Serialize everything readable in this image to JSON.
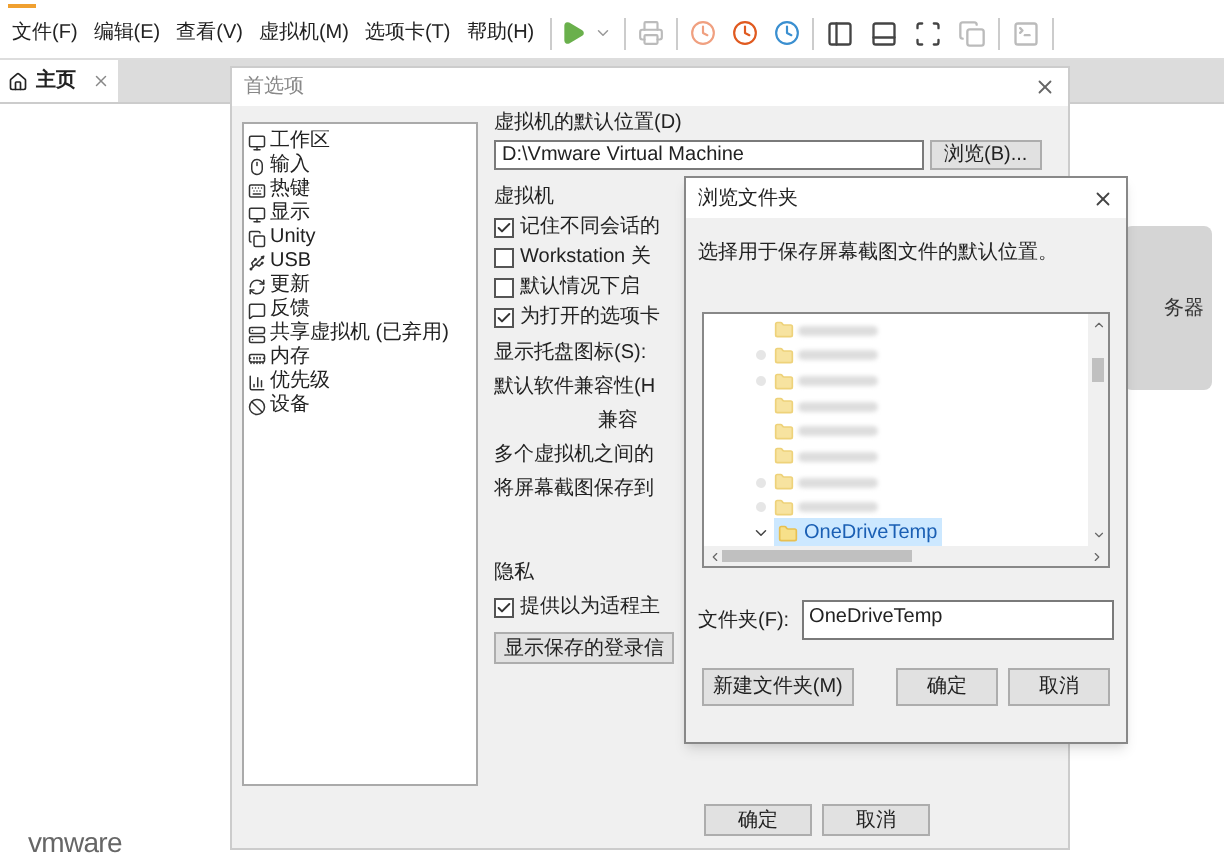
{
  "menu": [
    "文件(F)",
    "编辑(E)",
    "查看(V)",
    "虚拟机(M)",
    "选项卡(T)",
    "帮助(H)"
  ],
  "tabs": [
    {
      "label": "主页",
      "selected": true
    }
  ],
  "home": {
    "card_label": "务器",
    "logo": "vmware"
  },
  "preferences": {
    "title": "首选项",
    "categories": [
      {
        "label": "工作区"
      },
      {
        "label": "输入"
      },
      {
        "label": "热键"
      },
      {
        "label": "显示"
      },
      {
        "label": "Unity"
      },
      {
        "label": "USB"
      },
      {
        "label": "更新"
      },
      {
        "label": "反馈"
      },
      {
        "label": "共享虚拟机 (已弃用)"
      },
      {
        "label": "内存"
      },
      {
        "label": "优先级"
      },
      {
        "label": "设备"
      }
    ],
    "location_label": "虚拟机的默认位置(D)",
    "location_value": "D:\\Vmware Virtual Machine",
    "browse_button": "浏览(B)...",
    "vm_group": "虚拟机",
    "vm_options": [
      {
        "label": "记住不同会话的",
        "checked": true
      },
      {
        "label": "Workstation 关",
        "checked": false
      },
      {
        "label": "默认情况下启",
        "checked": false
      },
      {
        "label": "为打开的选项卡",
        "checked": true
      }
    ],
    "vm_lines": [
      {
        "text": "显示托盘图标(S):",
        "kind": "label"
      },
      {
        "text": "默认软件兼容性(H",
        "kind": "label"
      },
      {
        "text": "兼容",
        "kind": "sublabel"
      },
      {
        "text": "多个虚拟机之间的",
        "kind": "label"
      },
      {
        "text": "将屏幕截图保存到",
        "kind": "label"
      }
    ],
    "privacy_group": "隐私",
    "privacy_option": {
      "label": "提供以为适程主",
      "checked": true
    },
    "privacy_button": "显示保存的登录信",
    "buttons": [
      "确定",
      "取消"
    ]
  },
  "browse": {
    "title": "浏览文件夹",
    "description": "选择用于保存屏幕截图文件的默认位置。",
    "tree": [
      {
        "kind": "blurred",
        "expandable": false
      },
      {
        "kind": "blurred",
        "expandable": true
      },
      {
        "kind": "blurred",
        "expandable": true
      },
      {
        "kind": "blurred",
        "expandable": false
      },
      {
        "kind": "blurred",
        "expandable": false
      },
      {
        "kind": "blurred",
        "expandable": false
      },
      {
        "kind": "blurred",
        "expandable": true
      },
      {
        "kind": "blurred",
        "expandable": true
      },
      {
        "kind": "folder",
        "label": "OneDriveTemp",
        "selected": true,
        "expanded": true
      }
    ],
    "folder_label": "文件夹(F):",
    "folder_value": "OneDriveTemp",
    "new_folder_button": "新建文件夹(M)",
    "buttons": [
      "确定",
      "取消"
    ]
  }
}
